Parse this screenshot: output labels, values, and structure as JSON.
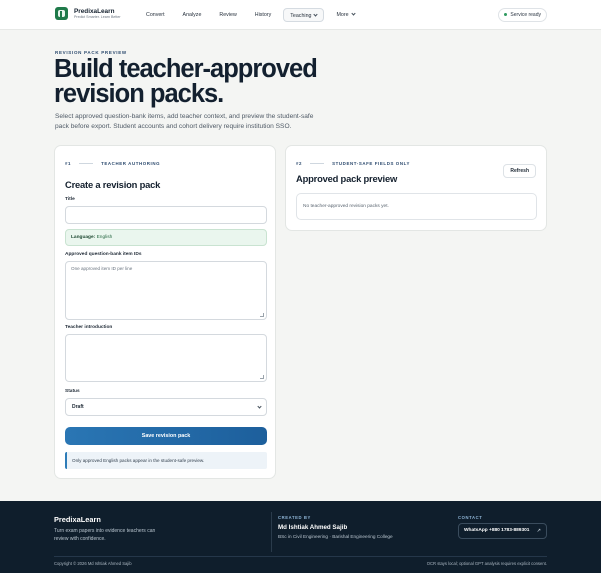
{
  "header": {
    "brand_name": "PredixaLearn",
    "brand_tagline": "Predict Smarter. Learn Better",
    "nav": [
      {
        "label": "Convert"
      },
      {
        "label": "Analyze"
      },
      {
        "label": "Review"
      },
      {
        "label": "History"
      },
      {
        "label": "Teaching",
        "active": true,
        "has_menu": true
      },
      {
        "label": "More",
        "has_menu": true
      }
    ],
    "status_label": "Service ready",
    "status_color": "#2f9a5f"
  },
  "hero": {
    "eyebrow": "REVISION PACK PREVIEW",
    "title": "Build teacher-approved revision packs.",
    "subtitle": "Select approved question-bank items, add teacher context, and preview the student-safe pack before export. Student accounts and cohort delivery require institution SSO."
  },
  "authoring": {
    "number": "#1",
    "kicker": "TEACHER AUTHORING",
    "title": "Create a revision pack",
    "title_label": "Title",
    "title_value": "",
    "language_key": "Language:",
    "language_value": "English",
    "items_label": "Approved question-bank item IDs",
    "items_placeholder": "One approved item ID per line",
    "intro_label": "Teacher introduction",
    "intro_value": "",
    "status_label": "Status",
    "status_value": "Draft",
    "save_label": "Save revision pack",
    "note": "Only approved English packs appear in the student-safe preview."
  },
  "preview": {
    "number": "#2",
    "kicker": "STUDENT-SAFE FIELDS ONLY",
    "title": "Approved pack preview",
    "refresh_label": "Refresh",
    "empty_text": "No teacher-approved revision packs yet."
  },
  "footer": {
    "brand_name": "PredixaLearn",
    "tagline": "Turn exam papers into evidence teachers can review with confidence.",
    "created_by_kicker": "CREATED BY",
    "author_name": "Md Ishtiak Ahmed Sajib",
    "author_degree": "BSc in Civil Engineering · Barishal Engineering College",
    "contact_kicker": "CONTACT",
    "contact_label": "WhatsApp +880 1783-889301",
    "copyright": "Copyright © 2026 Md Ishtiak Ahmed Sajib",
    "ocr_note": "OCR stays local; optional GPT analysis requires explicit consent."
  },
  "colors": {
    "accent": "#2a76b4",
    "footer_bg": "#0f1e2c",
    "success": "#1f7a4a"
  }
}
